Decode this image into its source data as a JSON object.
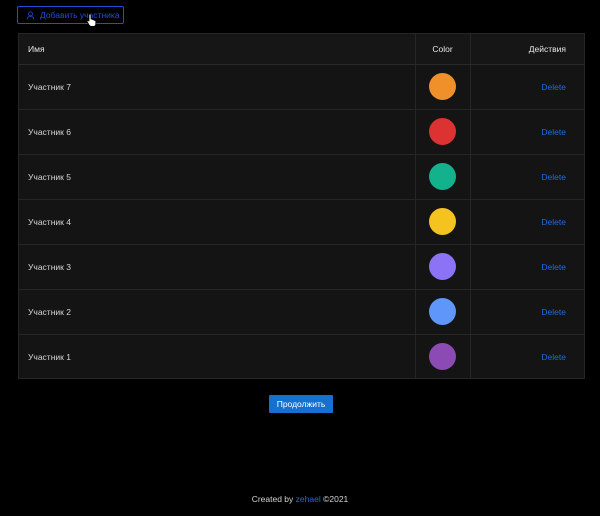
{
  "toolbar": {
    "add_label": "Добавить участника",
    "add_icon": "user-icon"
  },
  "table": {
    "headers": {
      "name": "Имя",
      "color": "Color",
      "actions": "Действия"
    },
    "rows": [
      {
        "name": "Участник 7",
        "color": "#f0902a",
        "action": "Delete"
      },
      {
        "name": "Участник 6",
        "color": "#dc3232",
        "action": "Delete"
      },
      {
        "name": "Участник 5",
        "color": "#14b28c",
        "action": "Delete"
      },
      {
        "name": "Участник 4",
        "color": "#f5c320",
        "action": "Delete"
      },
      {
        "name": "Участник 3",
        "color": "#8c73f5",
        "action": "Delete"
      },
      {
        "name": "Участник 2",
        "color": "#5f96fa",
        "action": "Delete"
      },
      {
        "name": "Участник 1",
        "color": "#8c4bb4",
        "action": "Delete"
      }
    ]
  },
  "continue_label": "Продолжить",
  "footer": {
    "prefix": "Created by",
    "author": "zehael",
    "suffix": "©2021"
  },
  "colors": {
    "accent": "#1570d0",
    "link": "#1d6ce0",
    "background": "#000000"
  }
}
